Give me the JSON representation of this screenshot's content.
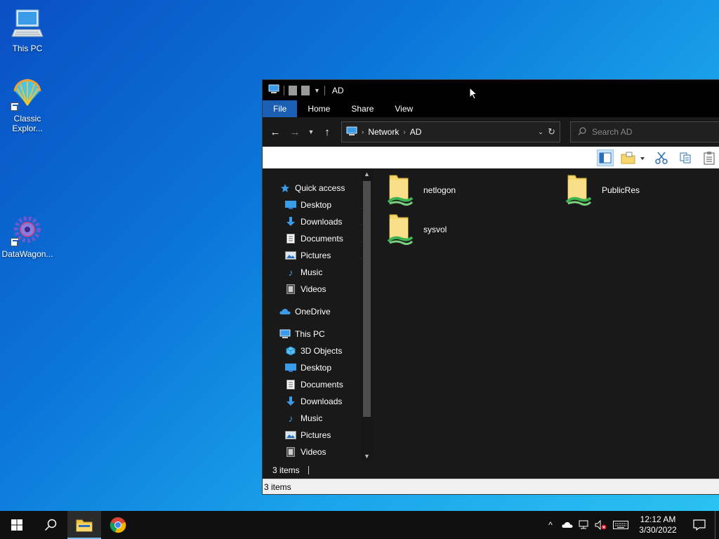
{
  "desktop": {
    "icons": [
      {
        "label": "This PC"
      },
      {
        "label": "Classic Explor..."
      },
      {
        "label": "DataWagon..."
      }
    ]
  },
  "window": {
    "title": "AD",
    "ribbon_tabs": [
      "File",
      "Home",
      "Share",
      "View"
    ],
    "address": {
      "crumbs": [
        "Network",
        "AD"
      ]
    },
    "search": {
      "placeholder": "Search AD"
    },
    "nav": {
      "quick_access": "Quick access",
      "quick_items": [
        "Desktop",
        "Downloads",
        "Documents",
        "Pictures",
        "Music",
        "Videos"
      ],
      "onedrive": "OneDrive",
      "this_pc": "This PC",
      "pc_items": [
        "3D Objects",
        "Desktop",
        "Documents",
        "Downloads",
        "Music",
        "Pictures",
        "Videos"
      ]
    },
    "files": [
      "netlogon",
      "PublicRes",
      "sysvol"
    ],
    "status_dark": "3 items",
    "status_light": "3 items"
  },
  "taskbar": {
    "time": "12:12 AM",
    "date": "3/30/2022"
  },
  "colors": {
    "accent": "#1a5fb4",
    "folder": "#f5d76e",
    "share": "#3fb34f"
  }
}
